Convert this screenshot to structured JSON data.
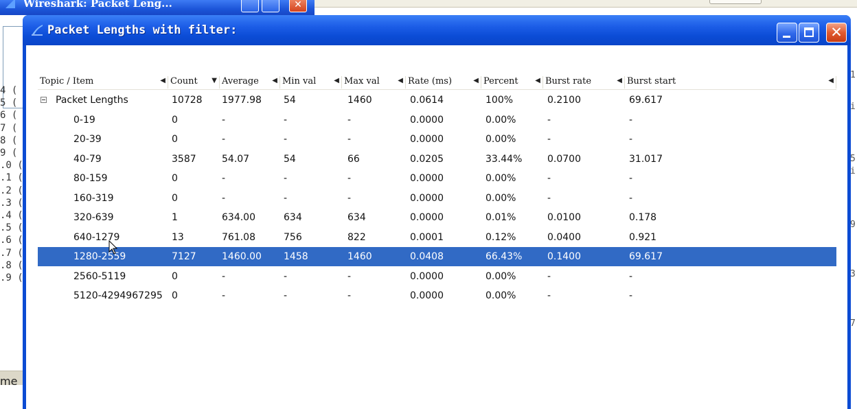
{
  "background_window": {
    "title": "Wireshark: Packet Leng...",
    "row_numbers": [
      "4 (",
      "5 (",
      "6 (",
      "7 (",
      "8 (",
      "9 (",
      ".0 (",
      ".1 (",
      ".2 (",
      ".3 (",
      ".4 (",
      ".5 (",
      ".6 (",
      ".7 (",
      ".8 (",
      ".9 ("
    ],
    "status_text": "me"
  },
  "dialog": {
    "title": "Packet Lengths with filter:",
    "buttons": {
      "minimize": "_",
      "maximize": "□",
      "close": "✕"
    }
  },
  "table": {
    "columns": [
      {
        "label": "Topic / Item",
        "sort_icon": "◀"
      },
      {
        "label": "Count",
        "sort_icon": "▼"
      },
      {
        "label": "Average",
        "sort_icon": "◀"
      },
      {
        "label": "Min val",
        "sort_icon": "◀"
      },
      {
        "label": "Max val",
        "sort_icon": "◀"
      },
      {
        "label": "Rate (ms)",
        "sort_icon": "◀"
      },
      {
        "label": "Percent",
        "sort_icon": "◀"
      },
      {
        "label": "Burst rate",
        "sort_icon": "◀"
      },
      {
        "label": "Burst start",
        "sort_icon": "◀"
      }
    ],
    "rows": [
      {
        "item": "Packet Lengths",
        "count": "10728",
        "average": "1977.98",
        "min": "54",
        "max": "1460",
        "rate": "0.0614",
        "percent": "100%",
        "burst_rate": "0.2100",
        "burst_start": "69.617",
        "expander": true,
        "selected": false
      },
      {
        "item": "0-19",
        "count": "0",
        "average": "-",
        "min": "-",
        "max": "-",
        "rate": "0.0000",
        "percent": "0.00%",
        "burst_rate": "-",
        "burst_start": "-",
        "selected": false
      },
      {
        "item": "20-39",
        "count": "0",
        "average": "-",
        "min": "-",
        "max": "-",
        "rate": "0.0000",
        "percent": "0.00%",
        "burst_rate": "-",
        "burst_start": "-",
        "selected": false
      },
      {
        "item": "40-79",
        "count": "3587",
        "average": "54.07",
        "min": "54",
        "max": "66",
        "rate": "0.0205",
        "percent": "33.44%",
        "burst_rate": "0.0700",
        "burst_start": "31.017",
        "selected": false
      },
      {
        "item": "80-159",
        "count": "0",
        "average": "-",
        "min": "-",
        "max": "-",
        "rate": "0.0000",
        "percent": "0.00%",
        "burst_rate": "-",
        "burst_start": "-",
        "selected": false
      },
      {
        "item": "160-319",
        "count": "0",
        "average": "-",
        "min": "-",
        "max": "-",
        "rate": "0.0000",
        "percent": "0.00%",
        "burst_rate": "-",
        "burst_start": "-",
        "selected": false
      },
      {
        "item": "320-639",
        "count": "1",
        "average": "634.00",
        "min": "634",
        "max": "634",
        "rate": "0.0000",
        "percent": "0.01%",
        "burst_rate": "0.0100",
        "burst_start": "0.178",
        "selected": false
      },
      {
        "item": "640-1279",
        "count": "13",
        "average": "761.08",
        "min": "756",
        "max": "822",
        "rate": "0.0001",
        "percent": "0.12%",
        "burst_rate": "0.0400",
        "burst_start": "0.921",
        "selected": false
      },
      {
        "item": "1280-2559",
        "count": "7127",
        "average": "1460.00",
        "min": "1458",
        "max": "1460",
        "rate": "0.0408",
        "percent": "66.43%",
        "burst_rate": "0.1400",
        "burst_start": "69.617",
        "selected": true
      },
      {
        "item": "2560-5119",
        "count": "0",
        "average": "-",
        "min": "-",
        "max": "-",
        "rate": "0.0000",
        "percent": "0.00%",
        "burst_rate": "-",
        "burst_start": "-",
        "selected": false
      },
      {
        "item": "5120-4294967295",
        "count": "0",
        "average": "-",
        "min": "-",
        "max": "-",
        "rate": "0.0000",
        "percent": "0.00%",
        "burst_rate": "-",
        "burst_start": "-",
        "selected": false
      }
    ]
  },
  "colors": {
    "titlebar": "#0b4cd6",
    "selection": "#316ac5",
    "close_button": "#e05a30"
  }
}
